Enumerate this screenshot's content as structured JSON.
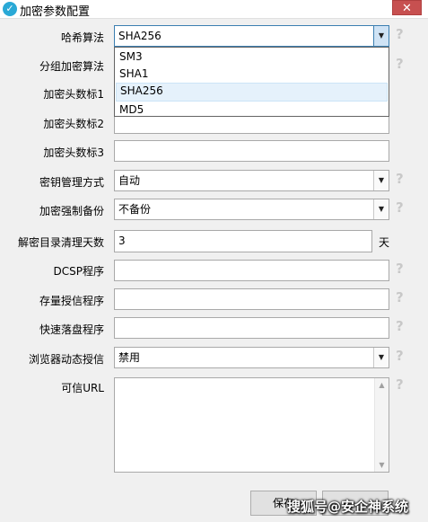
{
  "window": {
    "title": "加密参数配置",
    "close_label": "✕"
  },
  "form": {
    "hash_algorithm": {
      "label": "哈希算法",
      "value": "SHA256",
      "options": [
        "SM3",
        "SHA1",
        "SHA256",
        "MD5"
      ],
      "selected_option": "SHA256"
    },
    "block_cipher": {
      "label": "分组加密算法"
    },
    "header_mark_1": {
      "label": "加密头数标1",
      "value": ""
    },
    "header_mark_2": {
      "label": "加密头数标2",
      "value": ""
    },
    "header_mark_3": {
      "label": "加密头数标3",
      "value": ""
    },
    "key_management": {
      "label": "密钥管理方式",
      "value": "自动"
    },
    "forced_backup": {
      "label": "加密强制备份",
      "value": "不备份"
    },
    "cleanup_days": {
      "label": "解密目录清理天数",
      "value": "3",
      "unit": "天"
    },
    "dcsp_program": {
      "label": "DCSP程序",
      "value": ""
    },
    "storage_trust_program": {
      "label": "存量授信程序",
      "value": ""
    },
    "quick_write_program": {
      "label": "快速落盘程序",
      "value": ""
    },
    "browser_dynamic_trust": {
      "label": "浏览器动态授信",
      "value": "禁用"
    },
    "trusted_url": {
      "label": "可信URL",
      "value": ""
    }
  },
  "help_glyph": "?",
  "dropdown_arrow": "▼",
  "buttons": {
    "save": "保存",
    "cancel": ""
  },
  "watermark": "搜狐号@安企神系统",
  "colors": {
    "close": "#c75050",
    "icon": "#2aa9d6",
    "selected": "#e5f1fb"
  }
}
